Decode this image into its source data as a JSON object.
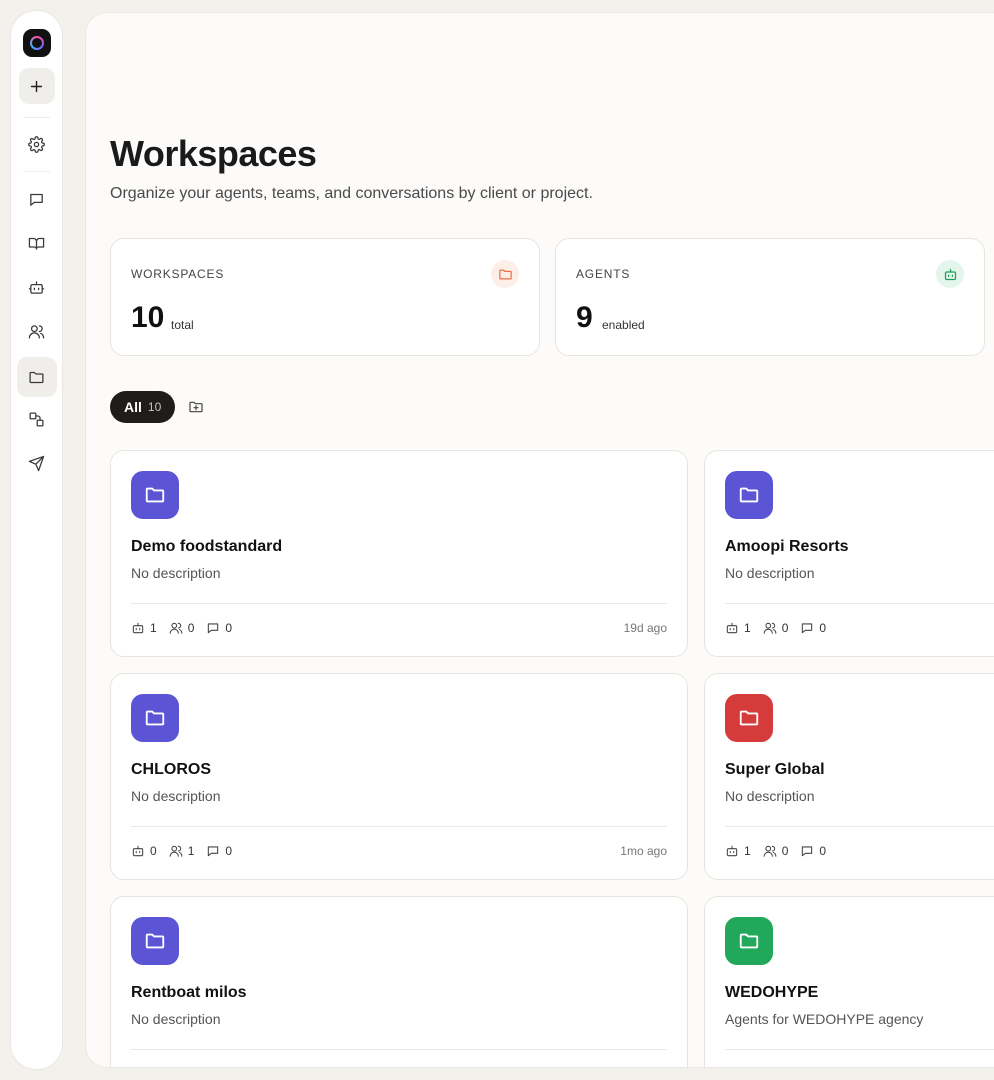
{
  "page": {
    "title": "Workspaces",
    "subtitle": "Organize your agents, teams, and conversations by client or project."
  },
  "stats": [
    {
      "label": "WORKSPACES",
      "value": "10",
      "unit": "total",
      "icon": "folder-icon",
      "icon_color": "#e8734a",
      "icon_bg": "#fdeee7"
    },
    {
      "label": "AGENTS",
      "value": "9",
      "unit": "enabled",
      "icon": "bot-icon",
      "icon_color": "#1e9e5a",
      "icon_bg": "#e4f5ec"
    }
  ],
  "filters": {
    "all_label": "All",
    "all_count": "10"
  },
  "workspaces": [
    {
      "name": "Demo foodstandard",
      "description": "No description",
      "agents": "1",
      "members": "0",
      "conversations": "0",
      "updated": "19d ago",
      "color": "#5b55d6"
    },
    {
      "name": "Amoopi Resorts",
      "description": "No description",
      "agents": "1",
      "members": "0",
      "conversations": "0",
      "updated": "",
      "color": "#5b55d6"
    },
    {
      "name": "CHLOROS",
      "description": "No description",
      "agents": "0",
      "members": "1",
      "conversations": "0",
      "updated": "1mo ago",
      "color": "#5b55d6"
    },
    {
      "name": "Super Global",
      "description": "No description",
      "agents": "1",
      "members": "0",
      "conversations": "0",
      "updated": "",
      "color": "#d63b3b"
    },
    {
      "name": "Rentboat milos",
      "description": "No description",
      "agents": "",
      "members": "",
      "conversations": "",
      "updated": "",
      "color": "#5b55d6"
    },
    {
      "name": "WEDOHYPE",
      "description": "Agents for WEDOHYPE agency",
      "agents": "",
      "members": "",
      "conversations": "",
      "updated": "",
      "color": "#22a85a"
    }
  ],
  "rail": {
    "items": [
      "settings-icon",
      "chat-icon",
      "book-icon",
      "bot-icon",
      "users-icon",
      "folder-icon",
      "shapes-icon",
      "send-icon"
    ],
    "active": "folder-icon"
  }
}
